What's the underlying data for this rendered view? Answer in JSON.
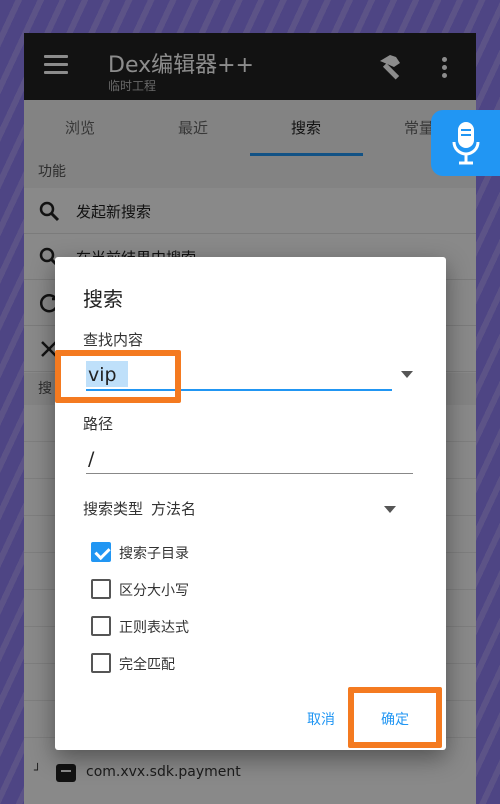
{
  "appbar": {
    "title": "Dex编辑器++",
    "subtitle": "临时工程"
  },
  "tabs": [
    {
      "label": "浏览"
    },
    {
      "label": "最近"
    },
    {
      "label": "搜索"
    },
    {
      "label": "常量"
    }
  ],
  "functions": {
    "header": "功能",
    "items": [
      {
        "label": "发起新搜索"
      },
      {
        "label": "在当前结果中搜索"
      }
    ]
  },
  "results": {
    "header": "搜",
    "last_item": "com.xvx.sdk.payment"
  },
  "dialog": {
    "title": "搜索",
    "content_label": "查找内容",
    "content_value": "vip",
    "path_label": "路径",
    "path_value": "/",
    "type_label": "搜索类型",
    "type_value": "方法名",
    "options": [
      {
        "label": "搜索子目录",
        "checked": true
      },
      {
        "label": "区分大小写",
        "checked": false
      },
      {
        "label": "正则表达式",
        "checked": false
      },
      {
        "label": "完全匹配",
        "checked": false
      }
    ],
    "cancel_label": "取消",
    "ok_label": "确定"
  },
  "colors": {
    "accent": "#2196f3",
    "highlight": "#f47a20",
    "appbar": "#212121"
  }
}
